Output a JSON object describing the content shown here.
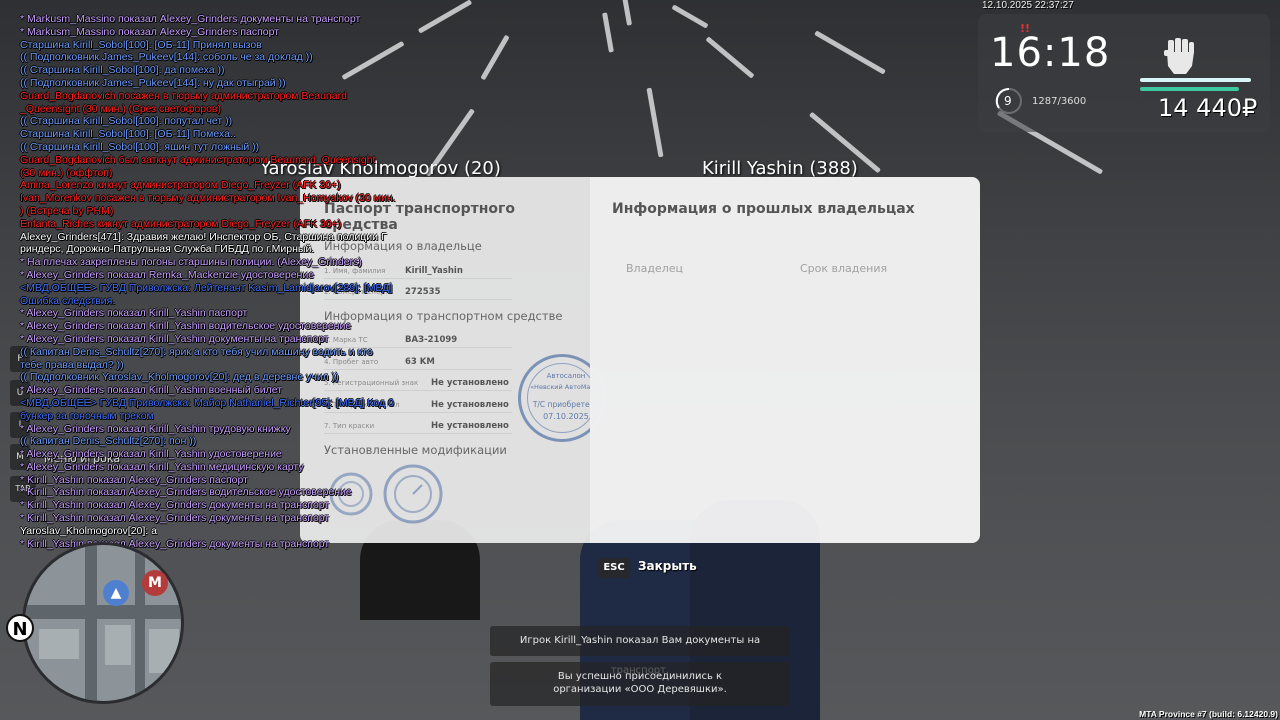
{
  "chat": [
    {
      "text": "* Markusm_Massino показал Alexey_Grinders документы на транспорт",
      "color": "#c8a0ff"
    },
    {
      "text": "* Markusm_Massino показал Alexey_Grinders паспорт",
      "color": "#c8a0ff"
    },
    {
      "text": "Старшина Kirill_Sobol[100]: [ОБ-11] Принял вызов",
      "color": "#6f9cff"
    },
    {
      "text": "(( Подполковник James_Pukeev[144]: соболь че за доклад ))",
      "color": "#6f9cff"
    },
    {
      "text": "(( Старшина Kirill_Sobol[100]: да помеха ))",
      "color": "#6f9cff"
    },
    {
      "text": "(( Подполковник James_Pukeev[144]: ну дак отыграй ))",
      "color": "#6f9cff"
    },
    {
      "text": "Guard_Bogdanovich посажен в тюрьму администратором Beaunard",
      "color": "#ff2020"
    },
    {
      "text": "_Queensight (30 мин.) (Срез светофоров)",
      "color": "#ff2020"
    },
    {
      "text": "(( Старшина Kirill_Sobol[100]: попутал чет ))",
      "color": "#6f9cff"
    },
    {
      "text": "Старшина Kirill_Sobol[100]: [ОБ-11] Помеха..",
      "color": "#6f9cff"
    },
    {
      "text": "(( Старшина Kirill_Sobol[100]: яшин тут ложный ))",
      "color": "#6f9cff"
    },
    {
      "text": "Guard_Bogdanovich был заткнут администратором Beaunard_Queensight",
      "color": "#ff2020"
    },
    {
      "text": "(30 мин.) (оффтоп)",
      "color": "#ff2020"
    },
    {
      "text": "Amina_Lorenzo кикнут администратором Diego_Freyzer (AFK 30+)",
      "color": "#ff2020"
    },
    {
      "text": "Ivan_Morenkov посажен в тюрьму администратором Ivan_Homyakov (30 мин.",
      "color": "#ff2020"
    },
    {
      "text": ") (Встреча by PHM)",
      "color": "#ff2020"
    },
    {
      "text": "Enfanta_Riches кикнут администратором Diego_Freyzer (AFK 30+)",
      "color": "#ff2020"
    },
    {
      "text": "Alexey_Grinders[471]: Здравия желаю! Инспектор ОБ, Старшина полиции Г",
      "color": "#ffffff"
    },
    {
      "text": "риндерс, Дорожно-Патрульная Служба ГИБДД по г.Мирный.",
      "color": "#ffffff"
    },
    {
      "text": "* На плечах закреплены погоны старшины полиции. (Alexey_Grinders)",
      "color": "#c8a0ff"
    },
    {
      "text": "* Alexey_Grinders показал Remka_Mackenzie удостоверение",
      "color": "#c8a0ff"
    },
    {
      "text": "<МВД.ОБЩЕЕ> ГУВД Приволжска: Лейтенант Kasim_Lamidjarov[289]: [МВД]",
      "color": "#3f6fff"
    },
    {
      "text": " Ошибка следствия.",
      "color": "#3f6fff"
    },
    {
      "text": "* Alexey_Grinders показал Kirill_Yashin паспорт",
      "color": "#c8a0ff"
    },
    {
      "text": "* Alexey_Grinders показал Kirill_Yashin водительское удостоверение",
      "color": "#c8a0ff"
    },
    {
      "text": "* Alexey_Grinders показал Kirill_Yashin документы на транспорт",
      "color": "#c8a0ff"
    },
    {
      "text": "(( Капитан Denis_Schultz[270]: ярик а кто тебя учил машину водить и кто",
      "color": "#6f9cff"
    },
    {
      "text": " тебе права выдал? ))",
      "color": "#6f9cff"
    },
    {
      "text": "(( Подполковник Yaroslav_Kholmogorov[20]: дед в деревне учил ))",
      "color": "#6f9cff"
    },
    {
      "text": "* Alexey_Grinders показал Kirill_Yashin военный билет",
      "color": "#c8a0ff"
    },
    {
      "text": "<МВД.ОБЩЕЕ> ГУВД Приволжска: Майор Nathaniel_Richter[95]: [МВД] Код 0",
      "color": "#3f6fff"
    },
    {
      "text": " бункер за гоночным треком",
      "color": "#3f6fff"
    },
    {
      "text": "* Alexey_Grinders показал Kirill_Yashin трудовую книжку",
      "color": "#c8a0ff"
    },
    {
      "text": "(( Капитан Denis_Schultz[270]: пон ))",
      "color": "#6f9cff"
    },
    {
      "text": "* Alexey_Grinders показал Kirill_Yashin удостоверение",
      "color": "#c8a0ff"
    },
    {
      "text": "* Alexey_Grinders показал Kirill_Yashin медицинскую карту",
      "color": "#c8a0ff"
    },
    {
      "text": "* Kirill_Yashin показал Alexey_Grinders паспорт",
      "color": "#c8a0ff"
    },
    {
      "text": "* Kirill_Yashin показал Alexey_Grinders водительское удостоверение",
      "color": "#c8a0ff"
    },
    {
      "text": "* Kirill_Yashin показал Alexey_Grinders документы на транспорт",
      "color": "#c8a0ff"
    },
    {
      "text": "* Kirill_Yashin показал Alexey_Grinders документы на транспорт",
      "color": "#c8a0ff"
    },
    {
      "text": "Yaroslav_Kholmogorov[20]: а",
      "color": "#ffffff"
    },
    {
      "text": "* Kirill_Yashin показал Alexey_Grinders документы на транспорт",
      "color": "#c8a0ff"
    }
  ],
  "hud": {
    "datetime": "12.10.2025 22:37:27",
    "wanted": "!!",
    "time": "16:18",
    "level": "9",
    "exp": "1287/3600",
    "money": "14 440₽",
    "health": 0.99,
    "armor": 0.88,
    "colors": {
      "health": "#d8f6f8",
      "armor": "#40c8a0"
    },
    "icon": "fist-icon"
  },
  "nametags": {
    "left": "Yaroslav Kholmogorov (20)",
    "right": "Kirill Yashin (388)"
  },
  "document": {
    "title": "Паспорт транспортного средства",
    "owner_section": "Информация о владельце",
    "owner_fields": [
      {
        "label": "1. Имя, фамилия",
        "value": "Kirill_Yashin"
      },
      {
        "label": "2. Номер паспорта",
        "value": "272535"
      }
    ],
    "vehicle_section": "Информация о транспортном средстве",
    "vehicle_fields": [
      {
        "label": "3. Марка ТС",
        "value": "ВАЗ-21099"
      },
      {
        "label": "4. Пробег авто",
        "value": "63 KM"
      },
      {
        "label": "5. Регистрационный знак",
        "value": "Не установлено"
      },
      {
        "label": "6. Тонировка стёкол",
        "value": "Не установлено"
      },
      {
        "label": "7. Тип краски",
        "value": "Не установлено"
      }
    ],
    "mods_section": "Установленные модификации",
    "stamp": {
      "top": "Автосалон",
      "name": "«Невский АвтоМакс»",
      "line1": "Т/С приобретено",
      "date": "07.10.2025"
    },
    "prev_owners_title": "Информация о прошлых владельцах",
    "col_owner": "Владелец",
    "col_period": "Срок владения"
  },
  "controls": {
    "esc_key": "ESC",
    "close_label": "Закрыть"
  },
  "notifications": [
    "Игрок Kirill_Yashin показал Вам документы на транспорт.",
    "Вы успешно присоединились к организации «ООО Деревяшки»."
  ],
  "side_hints": {
    "keys": [
      "F",
      "U",
      "I",
      "M",
      "TAB"
    ],
    "menu_label": "Меню игрока"
  },
  "minimap": {
    "north": "N"
  },
  "build": "MTA Province #7 (build: 6.12420.9)"
}
